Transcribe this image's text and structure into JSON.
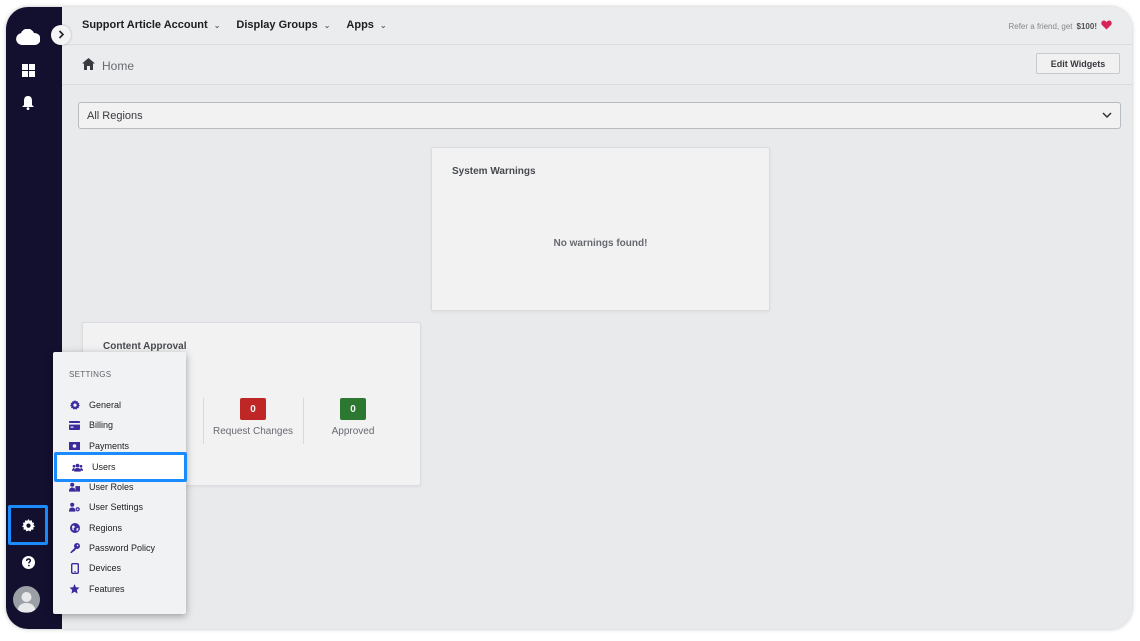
{
  "topbar": {
    "nav": [
      {
        "label": "Support Article Account"
      },
      {
        "label": "Display Groups"
      },
      {
        "label": "Apps"
      }
    ],
    "referral_prefix": "Refer a friend, get",
    "referral_amount": "$100!"
  },
  "breadcrumb": {
    "home_label": "Home"
  },
  "toolbar": {
    "edit_widgets_label": "Edit Widgets"
  },
  "region_filter": {
    "selected": "All Regions"
  },
  "system_warnings": {
    "title": "System Warnings",
    "empty_message": "No warnings found!"
  },
  "content_approval": {
    "title": "Content Approval",
    "stats": [
      {
        "label": "Request Changes",
        "count": "0",
        "color": "#c62828"
      },
      {
        "label": "Approved",
        "count": "0",
        "color": "#2e7d32"
      }
    ]
  },
  "settings_menu": {
    "heading": "SETTINGS",
    "items": [
      {
        "label": "General",
        "icon": "gear-icon"
      },
      {
        "label": "Billing",
        "icon": "credit-card-icon"
      },
      {
        "label": "Payments",
        "icon": "money-icon"
      },
      {
        "label": "Users",
        "icon": "users-icon"
      },
      {
        "label": "User Roles",
        "icon": "user-roles-icon"
      },
      {
        "label": "User Settings",
        "icon": "user-settings-icon"
      },
      {
        "label": "Regions",
        "icon": "globe-icon"
      },
      {
        "label": "Password Policy",
        "icon": "key-icon"
      },
      {
        "label": "Devices",
        "icon": "tablet-icon"
      },
      {
        "label": "Features",
        "icon": "star-icon"
      }
    ]
  },
  "colors": {
    "sidebar": "#130f2e",
    "highlight": "#1a8cff",
    "menu_icon": "#3d2a9c",
    "heart": "#e0245e"
  }
}
